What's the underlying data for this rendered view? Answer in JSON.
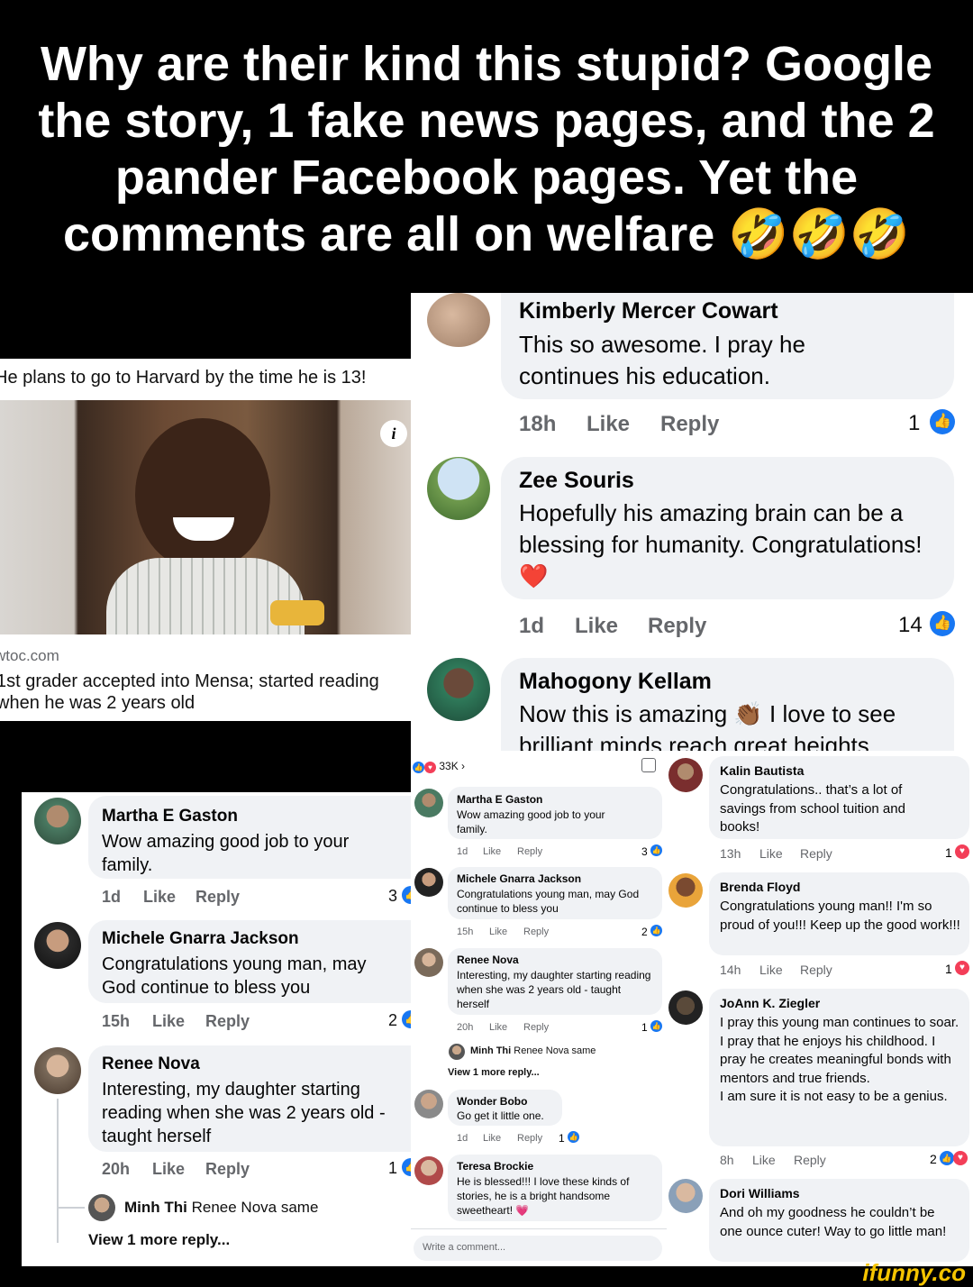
{
  "caption": {
    "text": "Why are their kind this stupid? Google the story, 1 fake news pages, and the 2 pander Facebook pages. Yet the comments are all on welfare",
    "emoji": "🤣🤣🤣"
  },
  "article": {
    "headline": "He plans to go to Harvard by the time he is 13!",
    "source": "wtoc.com",
    "title": "1st grader accepted into Mensa; started reading when he was 2 years old",
    "info_icon": "info-icon"
  },
  "top_comments": [
    {
      "name": "Kimberly Mercer Cowart",
      "text": "This so awesome. I pray he continues his education.",
      "time": "18h",
      "like": "Like",
      "reply": "Reply",
      "reactions": "1"
    },
    {
      "name": "Zee Souris",
      "text": "Hopefully his amazing brain can be a blessing for humanity. Congratulations!❤️",
      "time": "1d",
      "like": "Like",
      "reply": "Reply",
      "reactions": "14"
    },
    {
      "name": "Mahogony Kellam",
      "text": "Now this is amazing 👏🏾 I love to see brilliant minds reach great heights"
    }
  ],
  "left_comments": [
    {
      "name": "Martha E Gaston",
      "text": "Wow amazing good job to your family.",
      "time": "1d",
      "like": "Like",
      "reply": "Reply",
      "reactions": "3"
    },
    {
      "name": "Michele Gnarra Jackson",
      "text": "Congratulations young man, may God continue to bless you",
      "time": "15h",
      "like": "Like",
      "reply": "Reply",
      "reactions": "2"
    },
    {
      "name": "Renee Nova",
      "text": "Interesting, my daughter starting reading when she was 2 years old - taught herself",
      "time": "20h",
      "like": "Like",
      "reply": "Reply",
      "reactions": "1"
    }
  ],
  "left_reply": {
    "name": "Minh Thi",
    "text": "Renee Nova same",
    "more": "View 1 more reply..."
  },
  "middle": {
    "reactions_count": "33K",
    "comments": [
      {
        "name": "Martha E Gaston",
        "text": "Wow amazing good job to your family.",
        "time": "1d",
        "like": "Like",
        "reply": "Reply",
        "reactions": "3"
      },
      {
        "name": "Michele Gnarra Jackson",
        "text": "Congratulations young man, may God continue to bless you",
        "time": "15h",
        "like": "Like",
        "reply": "Reply",
        "reactions": "2"
      },
      {
        "name": "Renee Nova",
        "text": "Interesting, my daughter starting reading when she was 2 years old - taught herself",
        "time": "20h",
        "like": "Like",
        "reply": "Reply",
        "reactions": "1"
      },
      {
        "name": "Wonder Bobo",
        "text": "Go get it little one.",
        "time": "1d",
        "like": "Like",
        "reply": "Reply",
        "reactions": "1"
      },
      {
        "name": "Teresa Brockie",
        "text": "He is blessed!!! I love these kinds of stories, he is a bright handsome sweetheart! 💗"
      }
    ],
    "reply": {
      "name": "Minh Thi",
      "text": "Renee Nova same",
      "more": "View 1 more reply..."
    },
    "write_placeholder": "Write a comment..."
  },
  "right_comments": [
    {
      "name": "Kalin Bautista",
      "text": "Congratulations.. that’s a lot of savings from school tuition and books!",
      "time": "13h",
      "like": "Like",
      "reply": "Reply",
      "reactions": "1"
    },
    {
      "name": "Brenda Floyd",
      "text": "Congratulations young man!! I'm so proud of you!!! Keep up the good work!!!",
      "time": "14h",
      "like": "Like",
      "reply": "Reply",
      "reactions": "1"
    },
    {
      "name": "JoAnn K. Ziegler",
      "text": "I pray this young man continues to soar. I pray that he enjoys his childhood. I pray he creates meaningful bonds with mentors and true friends.\nI am sure it is not easy to be a genius.",
      "time": "8h",
      "like": "Like",
      "reply": "Reply",
      "reactions": "2"
    },
    {
      "name": "Dori Williams",
      "text": "And oh my goodness he couldn’t be one ounce cuter! Way to go little man!"
    }
  ],
  "watermark": "ifunny.co",
  "colors": {
    "like_blue": "#1877f2",
    "heart_red": "#f33e58",
    "bubble": "#f0f2f5",
    "meta_gray": "#65676b"
  }
}
